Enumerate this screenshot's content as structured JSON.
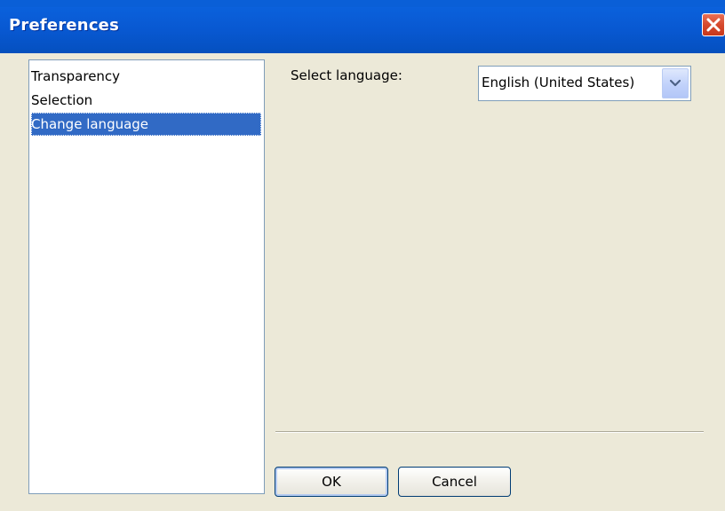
{
  "window": {
    "title": "Preferences"
  },
  "categories": {
    "items": [
      {
        "label": "Transparency",
        "selected": false
      },
      {
        "label": "Selection",
        "selected": false
      },
      {
        "label": "Change language",
        "selected": true
      }
    ]
  },
  "language": {
    "label": "Select language:",
    "selected_value": "English (United States)"
  },
  "buttons": {
    "ok_label": "OK",
    "cancel_label": "Cancel"
  },
  "colors": {
    "titlebar": "#0a5fd7",
    "selection": "#316ac5",
    "close_button": "#d6492d",
    "background": "#ece9d8"
  }
}
